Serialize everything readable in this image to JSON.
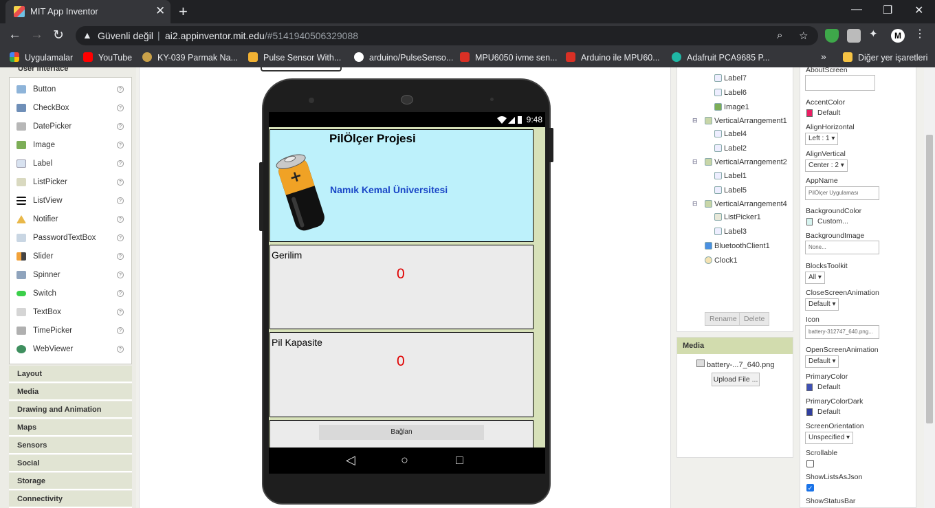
{
  "browser": {
    "tab_title": "MIT App Inventor",
    "new_tab": "+",
    "tab_close": "✕",
    "minimize": "—",
    "maximize": "❐",
    "close": "✕",
    "back": "←",
    "forward": "→",
    "reload": "↻",
    "security_label": "Güvenli değil",
    "url_host": "ai2.appinventor.mit.edu",
    "url_path": "/#5141940506329088",
    "zoom_icon": "search-icon",
    "star_icon": "star-icon",
    "bookmarks": [
      {
        "label": "Uygulamalar",
        "color": "#e94235"
      },
      {
        "label": "YouTube",
        "color": "#ff0000"
      },
      {
        "label": "KY-039 Parmak Na...",
        "color": "#caa24a"
      },
      {
        "label": "Pulse Sensor With...",
        "color": "#f2b233"
      },
      {
        "label": "arduino/PulseSenso...",
        "color": "#ffffff"
      },
      {
        "label": "MPU6050 ivme sen...",
        "color": "#d93025"
      },
      {
        "label": "Arduino ile MPU60...",
        "color": "#d93025"
      },
      {
        "label": "Adafruit PCA9685 P...",
        "color": "#1fb8a5"
      }
    ],
    "more_bookmarks": "»",
    "other_bookmarks": "Diğer yer işaretleri"
  },
  "palette": {
    "header": "User Interface",
    "items": [
      {
        "label": "Button",
        "color": "#8eb4d9"
      },
      {
        "label": "CheckBox",
        "color": "#6f8fb8"
      },
      {
        "label": "DatePicker",
        "color": "#b7b7b7"
      },
      {
        "label": "Image",
        "color": "#7dae57"
      },
      {
        "label": "Label",
        "color": "#d8e2f0"
      },
      {
        "label": "ListPicker",
        "color": "#d9d9c0"
      },
      {
        "label": "ListView",
        "color": "#111111"
      },
      {
        "label": "Notifier",
        "color": "#e9b84a"
      },
      {
        "label": "PasswordTextBox",
        "color": "#c9d6e3"
      },
      {
        "label": "Slider",
        "color": "#f2a23a"
      },
      {
        "label": "Spinner",
        "color": "#8fa4bd"
      },
      {
        "label": "Switch",
        "color": "#3bcf4a"
      },
      {
        "label": "TextBox",
        "color": "#d5d5d5"
      },
      {
        "label": "TimePicker",
        "color": "#b0b0b0"
      },
      {
        "label": "WebViewer",
        "color": "#3f8f5f"
      }
    ],
    "help": "?",
    "drawers": [
      "Layout",
      "Media",
      "Drawing and Animation",
      "Maps",
      "Sensors",
      "Social",
      "Storage",
      "Connectivity"
    ]
  },
  "phone": {
    "status_time": "9:48",
    "status_icons": "▾◢▮",
    "title": "PilÖlçer Projesi",
    "subtitle": "Namık Kemal Üniversitesi",
    "gerilim_label": "Gerilim",
    "gerilim_value": "0",
    "kapasite_label": "Pil Kapasite",
    "kapasite_value": "0",
    "connect_button": "Bağlan",
    "nav_back": "◁",
    "nav_home": "○",
    "nav_recent": "□"
  },
  "components": {
    "items": [
      {
        "label": "Label7",
        "indent": 2
      },
      {
        "label": "Label6",
        "indent": 2
      },
      {
        "label": "Image1",
        "indent": 2
      },
      {
        "label": "VerticalArrangement1",
        "indent": 1,
        "toggle": "⊟"
      },
      {
        "label": "Label4",
        "indent": 2
      },
      {
        "label": "Label2",
        "indent": 2
      },
      {
        "label": "VerticalArrangement2",
        "indent": 1,
        "toggle": "⊟"
      },
      {
        "label": "Label1",
        "indent": 2
      },
      {
        "label": "Label5",
        "indent": 2
      },
      {
        "label": "VerticalArrangement4",
        "indent": 1,
        "toggle": "⊟"
      },
      {
        "label": "ListPicker1",
        "indent": 2
      },
      {
        "label": "Label3",
        "indent": 2
      },
      {
        "label": "BluetoothClient1",
        "indent": 1
      },
      {
        "label": "Clock1",
        "indent": 1
      }
    ],
    "rename": "Rename",
    "delete": "Delete"
  },
  "media": {
    "header": "Media",
    "file": "battery-...7_640.png",
    "upload": "Upload File ..."
  },
  "properties": {
    "about_screen": "AboutScreen",
    "accent_color": "AccentColor",
    "accent_value": "Default",
    "accent_swatch": "#e91e63",
    "align_horizontal": "AlignHorizontal",
    "align_horizontal_value": "Left : 1 ▾",
    "align_vertical": "AlignVertical",
    "align_vertical_value": "Center : 2 ▾",
    "app_name": "AppName",
    "app_name_value": "PilÖlçer Uygulaması",
    "background_color": "BackgroundColor",
    "background_color_value": "Custom...",
    "background_swatch": "#d7f4f0",
    "background_image": "BackgroundImage",
    "background_image_value": "None...",
    "blocks_toolkit": "BlocksToolkit",
    "blocks_toolkit_value": "All ▾",
    "close_anim": "CloseScreenAnimation",
    "close_anim_value": "Default ▾",
    "icon": "Icon",
    "icon_value": "battery-312747_640.png...",
    "open_anim": "OpenScreenAnimation",
    "open_anim_value": "Default ▾",
    "primary_color": "PrimaryColor",
    "primary_color_value": "Default",
    "primary_swatch": "#3f51b5",
    "primary_dark": "PrimaryColorDark",
    "primary_dark_value": "Default",
    "primary_dark_swatch": "#303f9f",
    "orientation": "ScreenOrientation",
    "orientation_value": "Unspecified ▾",
    "scrollable": "Scrollable",
    "show_lists": "ShowListsAsJson",
    "show_status": "ShowStatusBar"
  }
}
